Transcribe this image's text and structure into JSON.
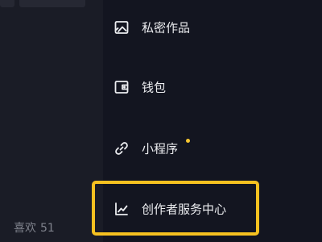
{
  "profile": {
    "likes_label": "喜欢",
    "likes_count": "51"
  },
  "menu": {
    "items": [
      {
        "label": "私密作品",
        "icon": "private-works-icon"
      },
      {
        "label": "钱包",
        "icon": "wallet-icon"
      },
      {
        "label": "小程序",
        "icon": "mini-program-link-icon",
        "badge_dot": true
      },
      {
        "label": "创作者服务中心",
        "icon": "creator-chart-icon",
        "highlighted": true
      }
    ]
  },
  "colors": {
    "background": "#131520",
    "left_pane": "#1a1c26",
    "text": "#ecedf0",
    "muted_text": "#7f828c",
    "badge_dot": "#f7c630",
    "highlight_border": "#f6c120"
  }
}
